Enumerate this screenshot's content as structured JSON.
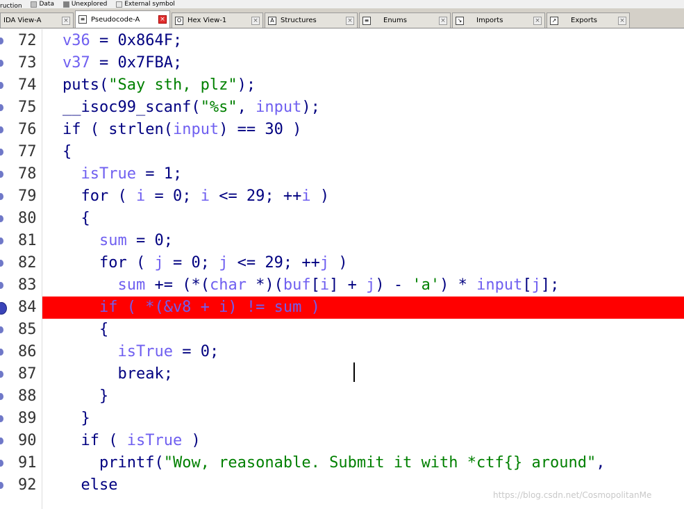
{
  "legend": {
    "items": [
      {
        "label": "ruction",
        "color": "#000080"
      },
      {
        "label": "Data",
        "color": "#c0c0c0"
      },
      {
        "label": "Unexplored",
        "color": "#808080"
      },
      {
        "label": "External symbol",
        "color": "#e8e8e8"
      }
    ]
  },
  "tabs": [
    {
      "label": "IDA View-A",
      "icon": "ida-view-icon"
    },
    {
      "label": "Pseudocode-A",
      "icon": "pseudocode-icon",
      "active": true
    },
    {
      "label": "Hex View-1",
      "icon": "hex-view-icon"
    },
    {
      "label": "Structures",
      "icon": "structures-icon"
    },
    {
      "label": "Enums",
      "icon": "enums-icon"
    },
    {
      "label": "Imports",
      "icon": "imports-icon"
    },
    {
      "label": "Exports",
      "icon": "exports-icon"
    }
  ],
  "code": {
    "lines": [
      {
        "num": "72",
        "text": "v36 = 0x864F;"
      },
      {
        "num": "73",
        "text": "v37 = 0x7FBA;"
      },
      {
        "num": "74",
        "text": "puts(\"Say sth, plz\");"
      },
      {
        "num": "75",
        "text": "__isoc99_scanf(\"%s\", input);"
      },
      {
        "num": "76",
        "text": "if ( strlen(input) == 30 )"
      },
      {
        "num": "77",
        "text": "{"
      },
      {
        "num": "78",
        "text": "  isTrue = 1;"
      },
      {
        "num": "79",
        "text": "  for ( i = 0; i <= 29; ++i )"
      },
      {
        "num": "80",
        "text": "  {"
      },
      {
        "num": "81",
        "text": "    sum = 0;"
      },
      {
        "num": "82",
        "text": "    for ( j = 0; j <= 29; ++j )"
      },
      {
        "num": "83",
        "text": "      sum += (*(char *)(buf[i] + j) - 'a') * input[j];"
      },
      {
        "num": "84",
        "text": "    if ( *(&v8 + i) != sum )",
        "breakpoint": true
      },
      {
        "num": "85",
        "text": "    {"
      },
      {
        "num": "86",
        "text": "      isTrue = 0;"
      },
      {
        "num": "87",
        "text": "      break;"
      },
      {
        "num": "88",
        "text": "    }"
      },
      {
        "num": "89",
        "text": "  }"
      },
      {
        "num": "90",
        "text": "  if ( isTrue )"
      },
      {
        "num": "91",
        "text": "    printf(\"Wow, reasonable. Submit it with *ctf{} around\","
      },
      {
        "num": "92",
        "text": "  else"
      }
    ]
  },
  "colors": {
    "breakpoint": "#ff0000",
    "keyword": "#000080",
    "variable": "#6f5ff0",
    "string": "#008000"
  },
  "watermark": "https://blog.csdn.net/CosmopolitanMe"
}
